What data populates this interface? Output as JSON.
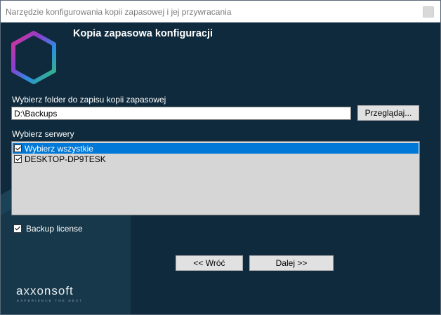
{
  "window": {
    "title": "Narzędzie konfigurowania kopii zapasowej i jej przywracania"
  },
  "header": {
    "heading": "Kopia zapasowa konfiguracji"
  },
  "folder": {
    "label": "Wybierz folder do zapisu kopii zapasowej",
    "value": "D:\\Backups",
    "browse_label": "Przeglądaj..."
  },
  "servers": {
    "label": "Wybierz serwery",
    "items": [
      {
        "label": "Wybierz wszystkie",
        "checked": true,
        "selected": true
      },
      {
        "label": "DESKTOP-DP9TESK",
        "checked": true,
        "selected": false
      }
    ]
  },
  "license": {
    "label": "Backup license",
    "checked": true
  },
  "buttons": {
    "back_label": "<< Wróć",
    "next_label": "Dalej >>"
  },
  "brand": {
    "name": "axxonsoft",
    "tagline": "EXPERIENCE THE NEXT"
  },
  "colors": {
    "background": "#0e2a3c",
    "selection": "#0078d7",
    "button": "#e1e1e1"
  }
}
